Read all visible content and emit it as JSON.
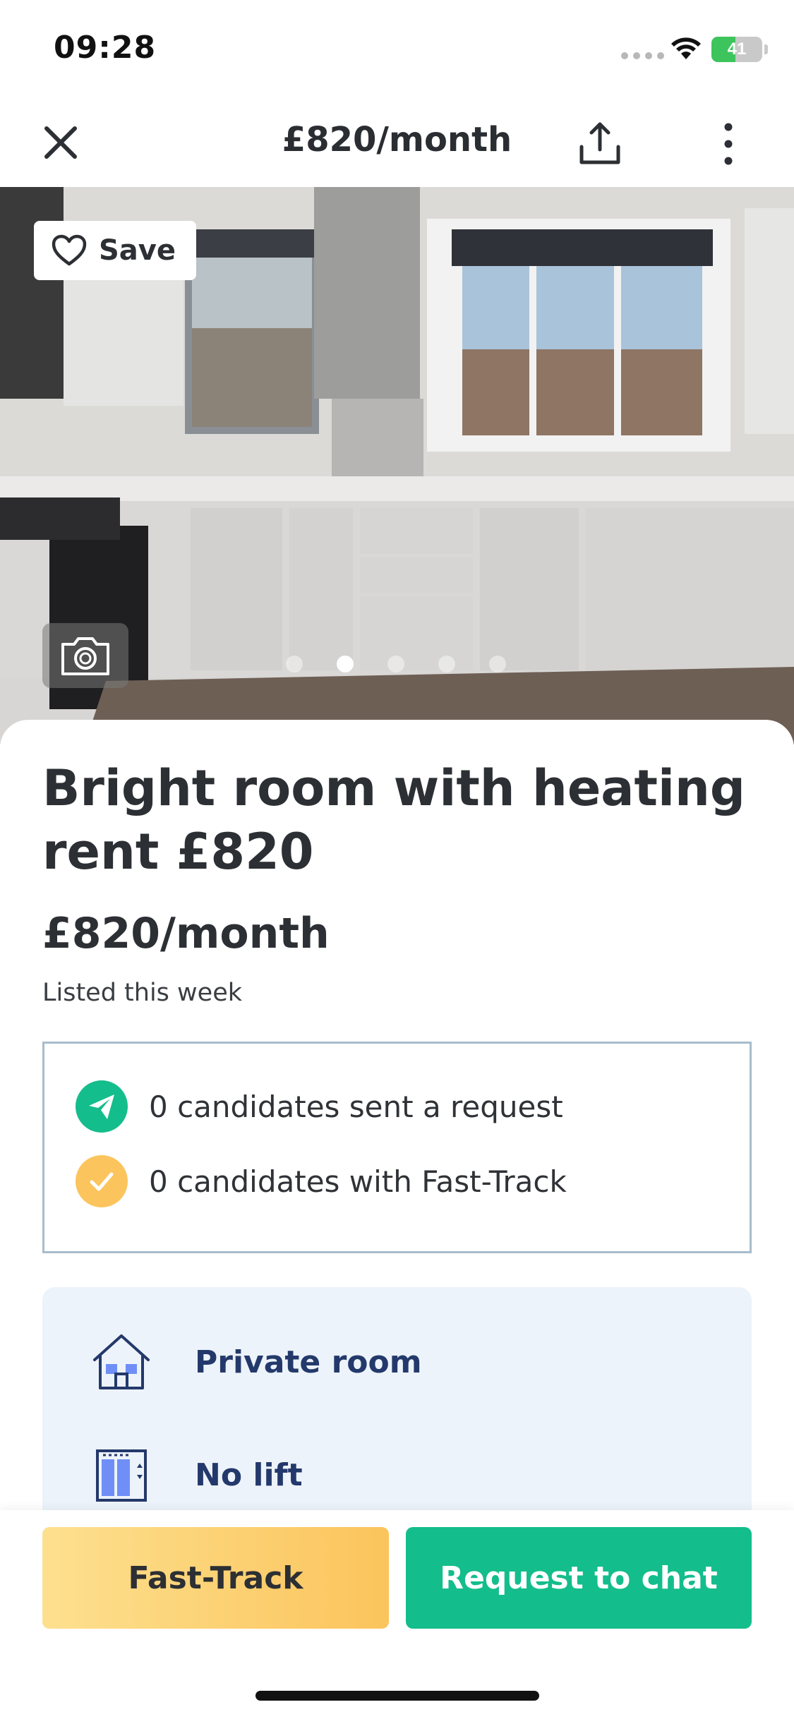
{
  "status_bar": {
    "time": "09:28",
    "battery": "41"
  },
  "nav": {
    "title": "£820/month"
  },
  "photo": {
    "save_label": "Save",
    "dots_total": 5,
    "active_dot": 2
  },
  "listing": {
    "title": "Bright room with heating rent £820",
    "price": "£820/month",
    "listed": "Listed this week"
  },
  "stats": [
    {
      "text": "0 candidates sent a request",
      "icon": "paper-plane-icon",
      "color": "#14bd8c"
    },
    {
      "text": "0 candidates with Fast-Track",
      "icon": "checkmark-icon",
      "color": "#fbc45c"
    }
  ],
  "features": [
    {
      "label": "Private room",
      "icon": "house-icon"
    },
    {
      "label": "No lift",
      "icon": "stairs-icon"
    }
  ],
  "actions": {
    "fast_track": "Fast-Track",
    "request_chat": "Request to chat"
  },
  "colors": {
    "accent_green": "#14bd8c",
    "accent_yellow": "#fbc45c",
    "feature_text": "#24396b",
    "feature_bg": "#edf3fa"
  }
}
